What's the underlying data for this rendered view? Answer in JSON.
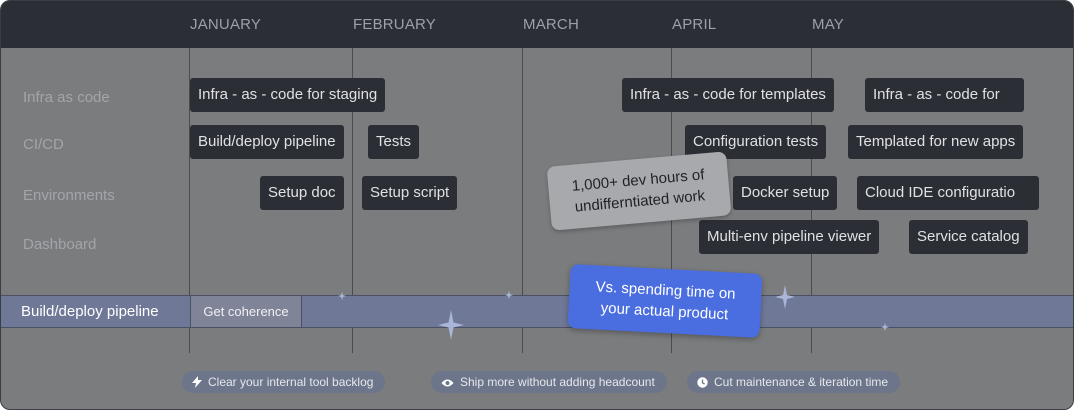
{
  "timeline": {
    "months": [
      "JANUARY",
      "FEBRUARY",
      "MARCH",
      "APRIL",
      "MAY"
    ]
  },
  "rows": [
    {
      "label": "Infra as code"
    },
    {
      "label": "CI/CD"
    },
    {
      "label": "Environments"
    },
    {
      "label": "Dashboard"
    }
  ],
  "tasks": {
    "infra_staging": "Infra - as - code for staging",
    "infra_templates": "Infra - as - code for templates",
    "infra_for": "Infra - as - code for",
    "build_deploy": "Build/deploy pipeline",
    "tests": "Tests",
    "config_tests": "Configuration tests",
    "templated_apps": "Templated for new apps",
    "setup_doc": "Setup doc",
    "setup_script": "Setup script",
    "docker_setup": "Docker setup",
    "cloud_ide": "Cloud IDE configuratio",
    "multi_env": "Multi-env pipeline viewer",
    "service_catalog": "Service catalog"
  },
  "highlight_row": {
    "label": "Build/deploy pipeline",
    "chip": "Get coherence"
  },
  "notes": {
    "dev_hours_line1": "1,000+ dev hours of",
    "dev_hours_line2": "undifferntiated work",
    "product_line1": "Vs. spending time on",
    "product_line2": "your actual product"
  },
  "benefits": [
    {
      "icon": "lightning-icon",
      "label": "Clear your internal tool backlog"
    },
    {
      "icon": "eye-icon",
      "label": "Ship more without adding headcount"
    },
    {
      "icon": "clock-icon",
      "label": "Cut maintenance & iteration time"
    }
  ],
  "colors": {
    "header": "#2b2e35",
    "background": "#7b7c7e",
    "chip": "#2b2e35",
    "band": "#6f7896",
    "blue_note": "#4a6ee0",
    "grey_note": "#a7a9ad"
  }
}
